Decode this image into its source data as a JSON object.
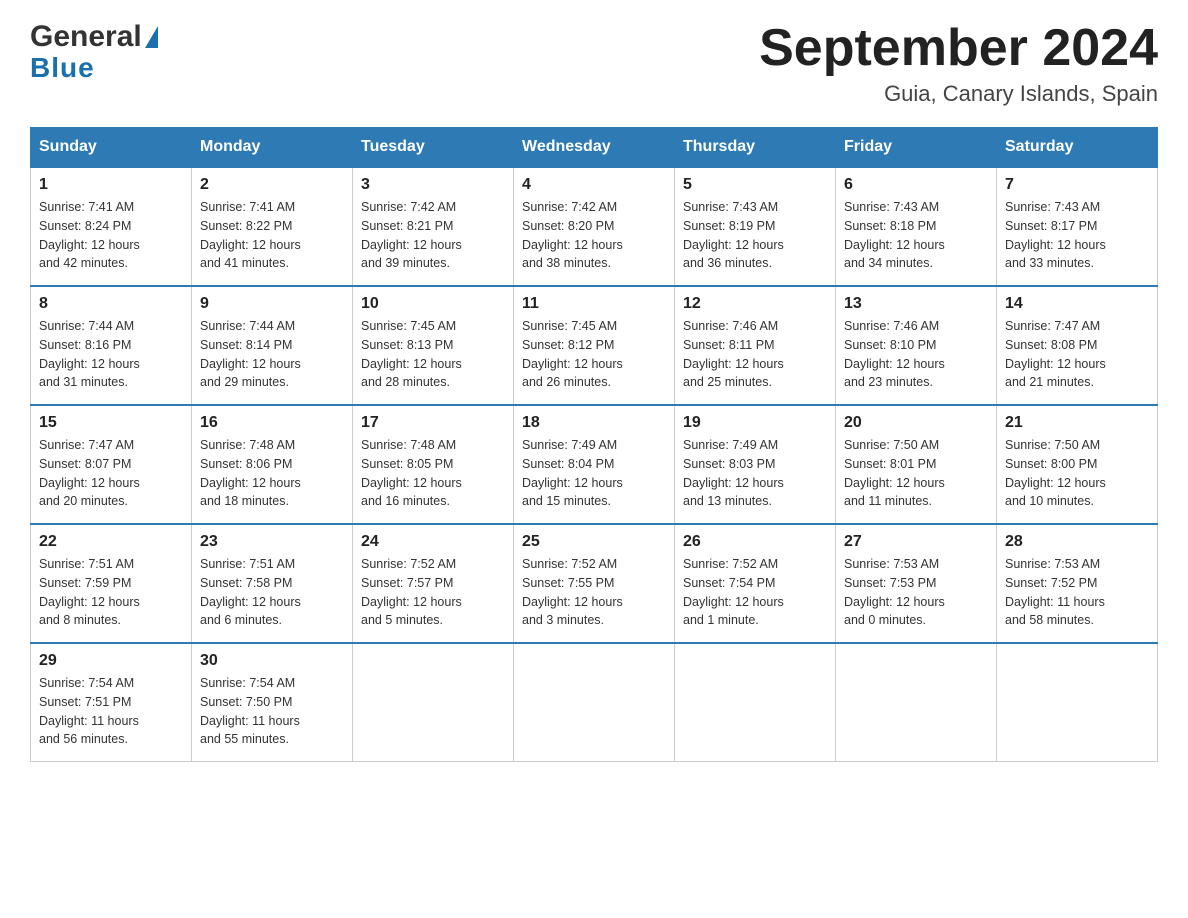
{
  "header": {
    "month_title": "September 2024",
    "location": "Guia, Canary Islands, Spain",
    "logo_line1": "General",
    "logo_line2": "Blue"
  },
  "days_of_week": [
    "Sunday",
    "Monday",
    "Tuesday",
    "Wednesday",
    "Thursday",
    "Friday",
    "Saturday"
  ],
  "weeks": [
    [
      {
        "day": "1",
        "sunrise": "7:41 AM",
        "sunset": "8:24 PM",
        "daylight": "12 hours and 42 minutes."
      },
      {
        "day": "2",
        "sunrise": "7:41 AM",
        "sunset": "8:22 PM",
        "daylight": "12 hours and 41 minutes."
      },
      {
        "day": "3",
        "sunrise": "7:42 AM",
        "sunset": "8:21 PM",
        "daylight": "12 hours and 39 minutes."
      },
      {
        "day": "4",
        "sunrise": "7:42 AM",
        "sunset": "8:20 PM",
        "daylight": "12 hours and 38 minutes."
      },
      {
        "day": "5",
        "sunrise": "7:43 AM",
        "sunset": "8:19 PM",
        "daylight": "12 hours and 36 minutes."
      },
      {
        "day": "6",
        "sunrise": "7:43 AM",
        "sunset": "8:18 PM",
        "daylight": "12 hours and 34 minutes."
      },
      {
        "day": "7",
        "sunrise": "7:43 AM",
        "sunset": "8:17 PM",
        "daylight": "12 hours and 33 minutes."
      }
    ],
    [
      {
        "day": "8",
        "sunrise": "7:44 AM",
        "sunset": "8:16 PM",
        "daylight": "12 hours and 31 minutes."
      },
      {
        "day": "9",
        "sunrise": "7:44 AM",
        "sunset": "8:14 PM",
        "daylight": "12 hours and 29 minutes."
      },
      {
        "day": "10",
        "sunrise": "7:45 AM",
        "sunset": "8:13 PM",
        "daylight": "12 hours and 28 minutes."
      },
      {
        "day": "11",
        "sunrise": "7:45 AM",
        "sunset": "8:12 PM",
        "daylight": "12 hours and 26 minutes."
      },
      {
        "day": "12",
        "sunrise": "7:46 AM",
        "sunset": "8:11 PM",
        "daylight": "12 hours and 25 minutes."
      },
      {
        "day": "13",
        "sunrise": "7:46 AM",
        "sunset": "8:10 PM",
        "daylight": "12 hours and 23 minutes."
      },
      {
        "day": "14",
        "sunrise": "7:47 AM",
        "sunset": "8:08 PM",
        "daylight": "12 hours and 21 minutes."
      }
    ],
    [
      {
        "day": "15",
        "sunrise": "7:47 AM",
        "sunset": "8:07 PM",
        "daylight": "12 hours and 20 minutes."
      },
      {
        "day": "16",
        "sunrise": "7:48 AM",
        "sunset": "8:06 PM",
        "daylight": "12 hours and 18 minutes."
      },
      {
        "day": "17",
        "sunrise": "7:48 AM",
        "sunset": "8:05 PM",
        "daylight": "12 hours and 16 minutes."
      },
      {
        "day": "18",
        "sunrise": "7:49 AM",
        "sunset": "8:04 PM",
        "daylight": "12 hours and 15 minutes."
      },
      {
        "day": "19",
        "sunrise": "7:49 AM",
        "sunset": "8:03 PM",
        "daylight": "12 hours and 13 minutes."
      },
      {
        "day": "20",
        "sunrise": "7:50 AM",
        "sunset": "8:01 PM",
        "daylight": "12 hours and 11 minutes."
      },
      {
        "day": "21",
        "sunrise": "7:50 AM",
        "sunset": "8:00 PM",
        "daylight": "12 hours and 10 minutes."
      }
    ],
    [
      {
        "day": "22",
        "sunrise": "7:51 AM",
        "sunset": "7:59 PM",
        "daylight": "12 hours and 8 minutes."
      },
      {
        "day": "23",
        "sunrise": "7:51 AM",
        "sunset": "7:58 PM",
        "daylight": "12 hours and 6 minutes."
      },
      {
        "day": "24",
        "sunrise": "7:52 AM",
        "sunset": "7:57 PM",
        "daylight": "12 hours and 5 minutes."
      },
      {
        "day": "25",
        "sunrise": "7:52 AM",
        "sunset": "7:55 PM",
        "daylight": "12 hours and 3 minutes."
      },
      {
        "day": "26",
        "sunrise": "7:52 AM",
        "sunset": "7:54 PM",
        "daylight": "12 hours and 1 minute."
      },
      {
        "day": "27",
        "sunrise": "7:53 AM",
        "sunset": "7:53 PM",
        "daylight": "12 hours and 0 minutes."
      },
      {
        "day": "28",
        "sunrise": "7:53 AM",
        "sunset": "7:52 PM",
        "daylight": "11 hours and 58 minutes."
      }
    ],
    [
      {
        "day": "29",
        "sunrise": "7:54 AM",
        "sunset": "7:51 PM",
        "daylight": "11 hours and 56 minutes."
      },
      {
        "day": "30",
        "sunrise": "7:54 AM",
        "sunset": "7:50 PM",
        "daylight": "11 hours and 55 minutes."
      },
      null,
      null,
      null,
      null,
      null
    ]
  ],
  "labels": {
    "sunrise": "Sunrise:",
    "sunset": "Sunset:",
    "daylight": "Daylight:"
  }
}
